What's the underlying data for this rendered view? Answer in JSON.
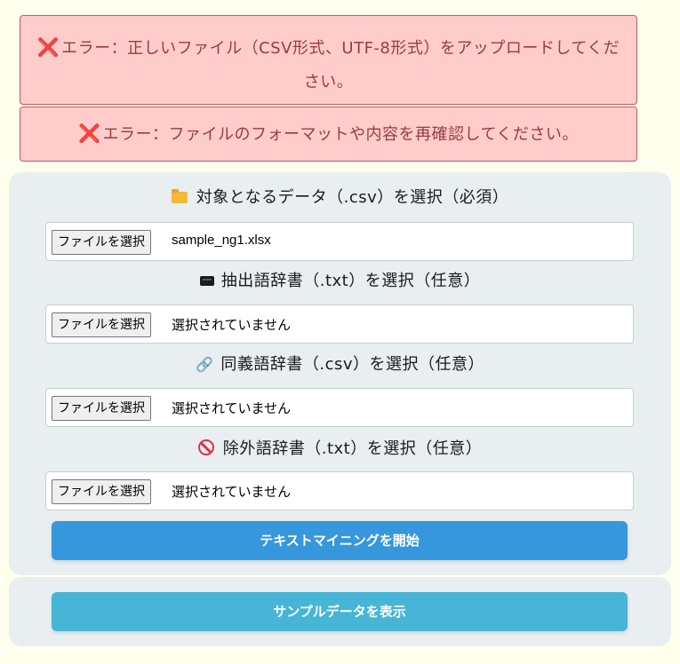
{
  "alerts": [
    {
      "icon": "cross-mark-icon",
      "mark": "❌",
      "text": "エラー：正しいファイル（CSV形式、UTF-8形式）をアップロードしてください。"
    },
    {
      "icon": "cross-mark-icon",
      "mark": "❌",
      "text": "エラー：ファイルのフォーマットや内容を再確認してください。"
    }
  ],
  "fields": [
    {
      "icon": "folder-icon",
      "label": "対象となるデータ（.csv）を選択（必須）",
      "button": "ファイルを選択",
      "filename": "sample_ng1.xlsx"
    },
    {
      "icon": "book-icon",
      "label": "抽出語辞書（.txt）を選択（任意）",
      "button": "ファイルを選択",
      "filename": "選択されていません"
    },
    {
      "icon": "link-icon",
      "label": "同義語辞書（.csv）を選択（任意）",
      "button": "ファイルを選択",
      "filename": "選択されていません"
    },
    {
      "icon": "prohibited-icon",
      "label": "除外語辞書（.txt）を選択（任意）",
      "button": "ファイルを選択",
      "filename": "選択されていません"
    }
  ],
  "buttons": {
    "start": "テキストマイニングを開始",
    "sample": "サンプルデータを表示"
  },
  "colors": {
    "alert_bg": "#ffcccc",
    "alert_text": "#9a3b3b",
    "primary_button": "#3697dd",
    "info_button": "#46b5d6",
    "page_bg": "#ffffee"
  }
}
